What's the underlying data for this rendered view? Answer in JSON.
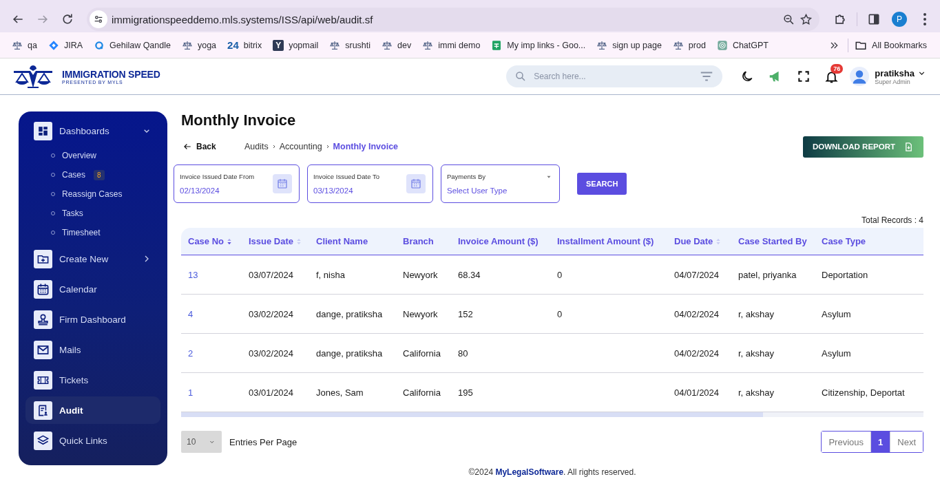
{
  "browser": {
    "url": "immigrationspeeddemo.mls.systems/ISS/api/web/audit.sf",
    "profile": "P",
    "bookmarks": [
      {
        "label": "qa",
        "kind": "scale"
      },
      {
        "label": "JIRA",
        "kind": "jira"
      },
      {
        "label": "Gehilaw Qandle",
        "kind": "ring"
      },
      {
        "label": "yoga",
        "kind": "scale"
      },
      {
        "label": "bitrix",
        "kind": "text",
        "icon_text": "24"
      },
      {
        "label": "yopmail",
        "kind": "tile",
        "icon_text": "Y"
      },
      {
        "label": "srushti",
        "kind": "scale"
      },
      {
        "label": "dev",
        "kind": "scale"
      },
      {
        "label": "immi demo",
        "kind": "scale"
      },
      {
        "label": "My imp links - Goo...",
        "kind": "sheets"
      },
      {
        "label": "sign up page",
        "kind": "scale"
      },
      {
        "label": "prod",
        "kind": "scale"
      },
      {
        "label": "ChatGPT",
        "kind": "chat"
      }
    ],
    "all_bookmarks": "All Bookmarks"
  },
  "header": {
    "brand": "IMMIGRATION SPEED",
    "tagline": "PRESENTED BY MYLS",
    "search": {
      "placeholder": "Search here..."
    },
    "notifications": "76",
    "user": {
      "name": "pratiksha",
      "role": "Super Admin"
    }
  },
  "sidebar": {
    "items": [
      {
        "label": "Dashboards",
        "kind": "group",
        "expanded": true,
        "selected": false,
        "children": [
          {
            "label": "Overview",
            "selected": false
          },
          {
            "label": "Cases",
            "badge": "8",
            "selected": false
          },
          {
            "label": "Reassign Cases",
            "selected": false
          },
          {
            "label": "Tasks",
            "selected": false
          },
          {
            "label": "Timesheet",
            "selected": false
          }
        ]
      },
      {
        "label": "Create New",
        "kind": "group",
        "expanded": false,
        "selected": false
      },
      {
        "label": "Calendar",
        "kind": "link",
        "selected": false
      },
      {
        "label": "Firm Dashboard",
        "kind": "link",
        "selected": false
      },
      {
        "label": "Mails",
        "kind": "link",
        "selected": false
      },
      {
        "label": "Tickets",
        "kind": "link",
        "selected": false
      },
      {
        "label": "Audit",
        "kind": "link",
        "selected": true
      },
      {
        "label": "Quick Links",
        "kind": "link",
        "selected": false
      }
    ]
  },
  "page": {
    "title": "Monthly Invoice",
    "back": "Back",
    "breadcrumbs": [
      {
        "label": "Audits",
        "current": false
      },
      {
        "label": "Accounting",
        "current": false
      },
      {
        "label": "Monthly Invoice",
        "current": true
      }
    ],
    "download": "DOWNLOAD REPORT",
    "filters": [
      {
        "kind": "date",
        "label": "Invoice Issued Date From",
        "value": "02/13/2024"
      },
      {
        "kind": "date",
        "label": "Invoice Issued Date To",
        "value": "03/13/2024"
      },
      {
        "kind": "select",
        "label": "Payments By",
        "placeholder": "Select User Type"
      }
    ],
    "search_button": "SEARCH",
    "total_records": "Total Records : 4",
    "table": {
      "columns": [
        {
          "label": "Case No",
          "sort_active": true
        },
        {
          "label": "Issue Date",
          "sort_active": false
        },
        {
          "label": "Client Name"
        },
        {
          "label": "Branch"
        },
        {
          "label": "Invoice Amount ($)"
        },
        {
          "label": "Installment Amount ($)"
        },
        {
          "label": "Due Date",
          "sort_active": false
        },
        {
          "label": "Case Started By"
        },
        {
          "label": "Case Type"
        }
      ],
      "rows": [
        [
          "13",
          "03/07/2024",
          "f, nisha",
          "Newyork",
          "68.34",
          "0",
          "04/07/2024",
          "patel, priyanka",
          "Deportation"
        ],
        [
          "4",
          "03/02/2024",
          "dange, pratiksha",
          "Newyork",
          "152",
          "0",
          "04/02/2024",
          "r, akshay",
          "Asylum"
        ],
        [
          "2",
          "03/02/2024",
          "dange, pratiksha",
          "California",
          "80",
          null,
          "04/02/2024",
          "r, akshay",
          "Asylum"
        ],
        [
          "1",
          "03/01/2024",
          "Jones, Sam",
          "California",
          "195",
          null,
          "04/01/2024",
          "r, akshay",
          "Citizenship, Deportat"
        ]
      ]
    },
    "page_size": "10",
    "page_size_label": "Entries Per Page",
    "pagination": {
      "previous": "Previous",
      "pages": [
        {
          "label": "1",
          "selected": true
        }
      ],
      "next": "Next"
    }
  },
  "footer": {
    "before": "©2024 ",
    "link": "MyLegalSoftware",
    "after": ". All rights reserved."
  }
}
